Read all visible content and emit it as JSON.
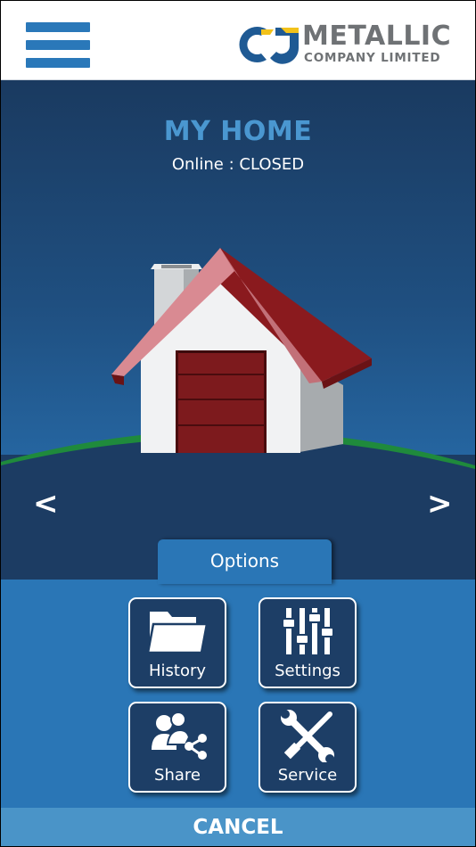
{
  "header": {
    "menu_icon": "hamburger-menu-icon",
    "logo": {
      "line1": "METALLIC",
      "line2": "COMPANY LIMITED",
      "mark": "CJ"
    }
  },
  "device": {
    "name": "MY HOME",
    "status": "Online : CLOSED"
  },
  "nav": {
    "prev": "<",
    "next": ">"
  },
  "options": {
    "tab_label": "Options",
    "items": [
      {
        "label": "History",
        "icon": "folder-icon"
      },
      {
        "label": "Settings",
        "icon": "sliders-icon"
      },
      {
        "label": "Share",
        "icon": "share-users-icon"
      },
      {
        "label": "Service",
        "icon": "wrench-screwdriver-icon"
      }
    ]
  },
  "cancel_label": "CANCEL",
  "colors": {
    "accent": "#2a76b6",
    "title": "#4a97d0",
    "tile_bg": "#1d3e66",
    "roof": "#8a1a1e",
    "garage_door": "#7d1a1d",
    "grass": "#1f8a3c"
  }
}
